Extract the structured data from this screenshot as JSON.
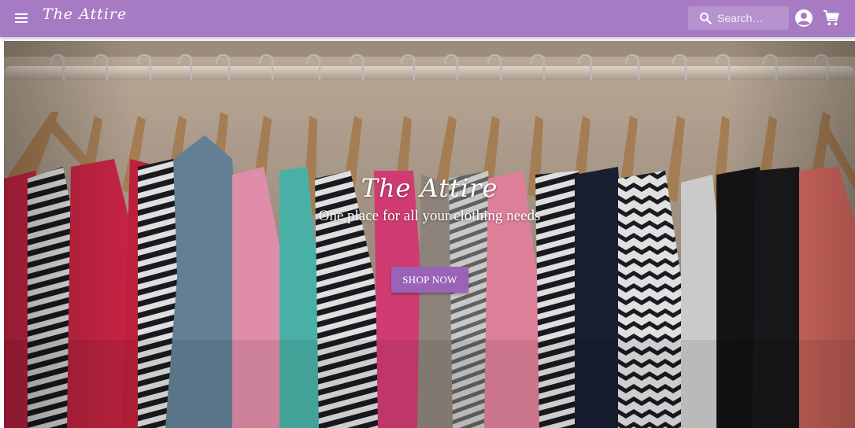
{
  "header": {
    "brand": "The Attire",
    "menu_icon": "menu-icon",
    "search": {
      "icon": "search-icon",
      "placeholder": "Search…",
      "value": ""
    },
    "account_icon": "account-circle-icon",
    "cart_icon": "shopping-cart-icon",
    "colors": {
      "bar": "#a77bc4",
      "text": "#ffffff"
    }
  },
  "hero": {
    "image": "clothes-on-hangers-rack",
    "title": "The Attire",
    "subtitle": "One place for all your clothing needs",
    "cta_label": "SHOP NOW",
    "colors": {
      "cta": "#9b63b7"
    }
  }
}
